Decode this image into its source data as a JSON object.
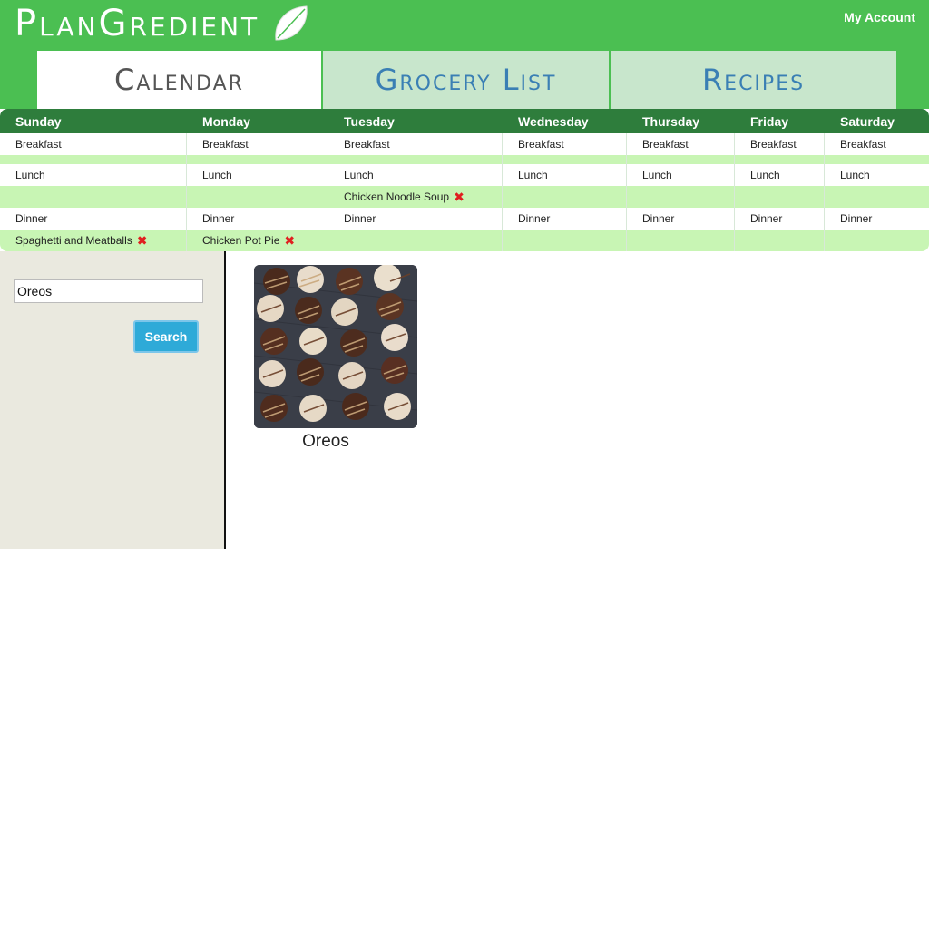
{
  "header": {
    "logo_text": "PlanGredient",
    "account_label": "My Account"
  },
  "tabs": [
    {
      "label": "Calendar",
      "active": true
    },
    {
      "label": "Grocery List",
      "active": false
    },
    {
      "label": "Recipes",
      "active": false
    }
  ],
  "calendar": {
    "days": [
      "Sunday",
      "Monday",
      "Tuesday",
      "Wednesday",
      "Thursday",
      "Friday",
      "Saturday"
    ],
    "breakfast_label": "Breakfast",
    "lunch_label": "Lunch",
    "dinner_label": "Dinner",
    "meals": {
      "tuesday_lunch": "Chicken Noodle Soup",
      "sunday_dinner": "Spaghetti and Meatballs",
      "monday_dinner": "Chicken Pot Pie"
    },
    "delete_icon": "✖"
  },
  "search": {
    "value": "Oreos",
    "button_label": "Search"
  },
  "results": [
    {
      "title": "Oreos"
    }
  ],
  "colors": {
    "brand_green": "#4bbf52",
    "header_dark_green": "#2e7d3c",
    "light_green_row": "#c8f5b4",
    "tab_inactive": "#c8e6cc",
    "tab_text_blue": "#3a7fb4",
    "search_button": "#2eaad8",
    "sidebar_bg": "#eae9df",
    "delete_red": "#e02020"
  }
}
